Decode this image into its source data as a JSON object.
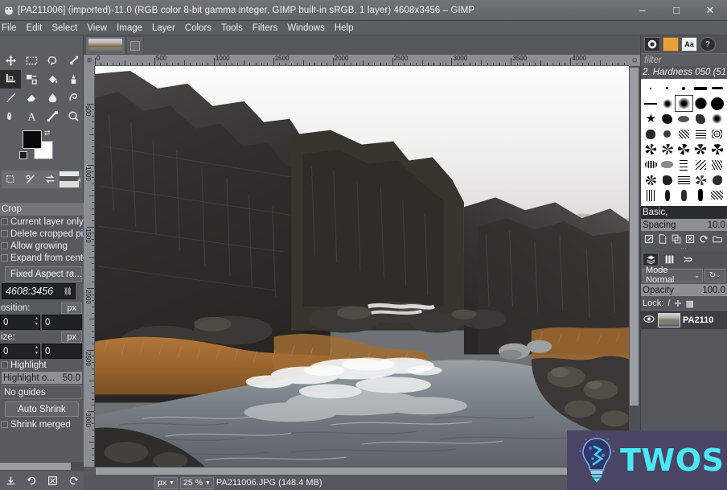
{
  "window": {
    "title": "[PA211006] (imported)-11.0 (RGB color 8-bit gamma integer, GIMP built-in sRGB, 1 layer) 4608x3456 – GIMP",
    "app_icon": "gimp-wilber-icon",
    "minimize": "–",
    "maximize": "□",
    "close": "✕"
  },
  "menubar": {
    "items": [
      {
        "label": "File"
      },
      {
        "label": "Edit"
      },
      {
        "label": "Select"
      },
      {
        "label": "View"
      },
      {
        "label": "Image"
      },
      {
        "label": "Layer"
      },
      {
        "label": "Colors"
      },
      {
        "label": "Tools"
      },
      {
        "label": "Filters"
      },
      {
        "label": "Windows"
      },
      {
        "label": "Help"
      }
    ]
  },
  "toolbox": {
    "tools": [
      {
        "name": "move-tool",
        "glyph": "✥"
      },
      {
        "name": "rectangle-select-tool",
        "glyph": "▭"
      },
      {
        "name": "free-select-tool",
        "glyph": "◌"
      },
      {
        "name": "measure-tool",
        "glyph": "↗"
      },
      {
        "name": "crop-tool",
        "glyph": "⌗"
      },
      {
        "name": "transform-tool",
        "glyph": "⤢"
      },
      {
        "name": "bucket-fill-tool",
        "glyph": "◣"
      },
      {
        "name": "gradient-tool",
        "glyph": "▨"
      },
      {
        "name": "paintbrush-tool",
        "glyph": "🖌"
      },
      {
        "name": "eraser-tool",
        "glyph": "◇"
      },
      {
        "name": "smudge-tool",
        "glyph": "☂"
      },
      {
        "name": "clone-tool",
        "glyph": "❂"
      },
      {
        "name": "ink-tool",
        "glyph": "✒"
      },
      {
        "name": "text-tool",
        "glyph": "A"
      },
      {
        "name": "paths-tool",
        "glyph": "✎"
      },
      {
        "name": "zoom-tool",
        "glyph": "🔍"
      }
    ],
    "selected_tool_index": 4,
    "foreground_color": "#0a0a0a",
    "background_color": "#ffffff",
    "indicators": [
      {
        "name": "brush-indicator",
        "glyph": "◰"
      },
      {
        "name": "pattern-indicator",
        "glyph": "%"
      },
      {
        "name": "gradient-indicator",
        "glyph": "⇄"
      },
      {
        "name": "image-indicator",
        "glyph": ""
      }
    ],
    "bottom_buttons": [
      {
        "name": "save-tool-options-button",
        "glyph": "⬇"
      },
      {
        "name": "restore-tool-options-button",
        "glyph": "↺"
      },
      {
        "name": "delete-tool-options-button",
        "glyph": "✖"
      },
      {
        "name": "reset-tool-options-button",
        "glyph": "↻"
      }
    ]
  },
  "tool_options": {
    "title": "Crop",
    "checkboxes": [
      {
        "label": "Current layer only",
        "checked": false
      },
      {
        "label": "Delete cropped pix",
        "checked": false
      },
      {
        "label": "Allow growing",
        "checked": false
      },
      {
        "label": "Expand from center",
        "checked": false
      }
    ],
    "fixed_button": "Fixed Aspect ra...",
    "aspect_value": "4608:3456",
    "position_label": "osition:",
    "position_unit": "px",
    "position_x": "0",
    "position_y": "0",
    "size_label": "ize:",
    "size_unit": "px",
    "size_w": "0",
    "size_h": "0",
    "highlight_label": "Highlight",
    "highlight_opacity_label": "Highlight o...",
    "highlight_opacity_value": "50.0",
    "guides": "No guides",
    "auto_shrink": "Auto Shrink",
    "shrink_merged": "Shrink merged"
  },
  "canvas": {
    "ruler_h_ticks": [
      "0",
      "500",
      "1000",
      "1500",
      "2000",
      "2500",
      "3000",
      "3500",
      "4000",
      "450"
    ],
    "ruler_v_ticks": [
      "500",
      "1000",
      "1500",
      "2000",
      "2500",
      "3000"
    ],
    "corner_icon": "ruler-origin-icon",
    "corner_icon_right": "quickmask-icon",
    "image_description": "Iceland basalt canyon river landscape with dark volcanic rock cliffs, orange dry grass and white rapids"
  },
  "statusbar": {
    "unit": "px",
    "zoom": "25 %",
    "text": "PA211006.JPG (148.4 MB)"
  },
  "dock": {
    "tabs": [
      {
        "name": "brushes-tab",
        "glyph": "●"
      },
      {
        "name": "gradients-tab",
        "glyph": ""
      },
      {
        "name": "fonts-tab",
        "glyph": "Aa"
      },
      {
        "name": "help-tab",
        "glyph": "?"
      }
    ],
    "filter_placeholder": "filter",
    "brush_name": "2. Hardness 050 (51",
    "brush_group": "Basic,",
    "spacing_label": "Spacing",
    "spacing_value": "10.0",
    "brush_buttons": [
      {
        "name": "edit-brush-button",
        "glyph": "✎"
      },
      {
        "name": "new-brush-button",
        "glyph": "🗋"
      },
      {
        "name": "duplicate-brush-button",
        "glyph": "❐"
      },
      {
        "name": "delete-brush-button",
        "glyph": "✖"
      },
      {
        "name": "refresh-brushes-button",
        "glyph": "↻"
      },
      {
        "name": "open-brush-as-image-button",
        "glyph": "🗁"
      }
    ],
    "layer_tabs": [
      {
        "name": "layers-tab",
        "glyph": "≡"
      },
      {
        "name": "channels-tab",
        "glyph": "|||"
      },
      {
        "name": "paths-tab",
        "glyph": "✕"
      }
    ],
    "mode_label": "Mode Normal",
    "mode_arrow": "⌄",
    "mode_extra_glyph": "↻",
    "opacity_label": "Opacity",
    "opacity_value": "100.0",
    "lock_label": "Lock:",
    "lock_icons": [
      "/",
      "✛",
      "▩"
    ],
    "layer": {
      "visible_icon": "eye-icon",
      "name": "PA2110"
    }
  },
  "watermark": {
    "text": "TWOS",
    "icon": "lightbulb-icon",
    "background": "#4a4565",
    "accent": "#49e8f5"
  }
}
